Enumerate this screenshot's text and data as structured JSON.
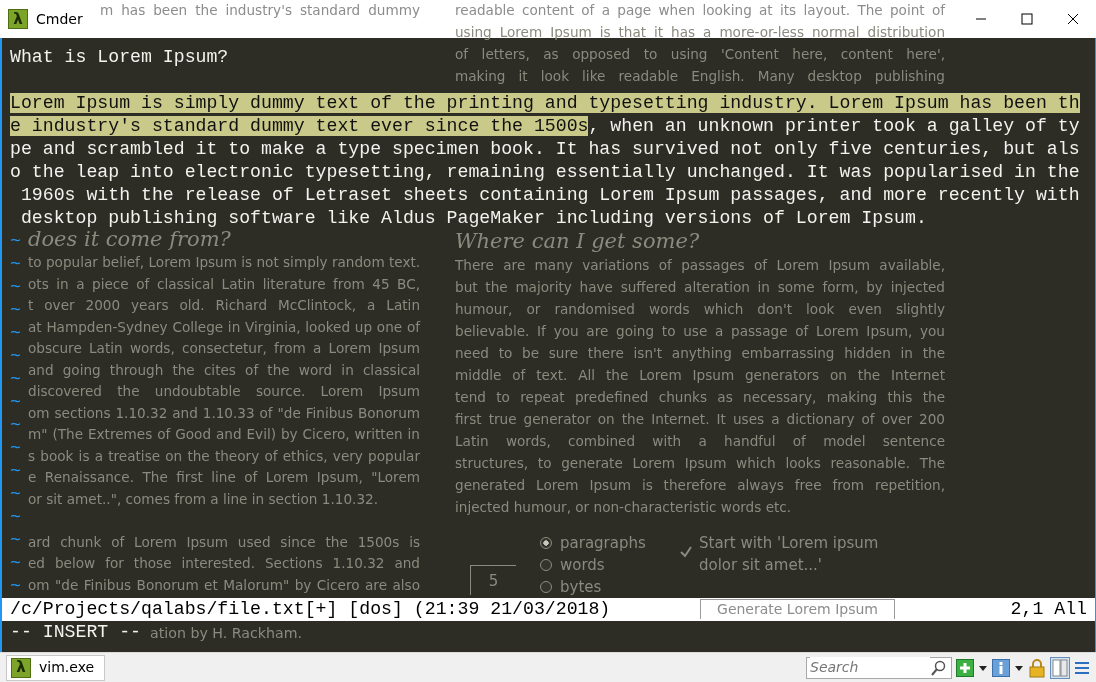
{
  "window": {
    "title": "Cmder",
    "icon_glyph": "λ"
  },
  "terminal": {
    "heading": "What is Lorem Ipsum?",
    "lines": [
      [
        {
          "text": "Lorem Ipsum is simply dummy text of the printing and typesetting industry. Lorem Ipsum has been th",
          "selected": true
        }
      ],
      [
        {
          "text": "e industry's standard dummy text ever since the 1500s",
          "selected": true
        },
        {
          "text": ", when an unknown printer took a galley of ty",
          "selected": false
        }
      ],
      [
        {
          "text": "pe and scrambled it to make a type specimen book. It has survived not only five centuries, but als",
          "selected": false
        }
      ],
      [
        {
          "text": "o the leap into electronic typesetting, remaining essentially unchanged. It was popularised in the",
          "selected": false
        }
      ],
      [
        {
          "text": " 1960s with the release of Letraset sheets containing Lorem Ipsum passages, and more recently with",
          "selected": false
        }
      ],
      [
        {
          "text": " desktop publishing software like Aldus PageMaker including versions of Lorem Ipsum.",
          "selected": false
        }
      ]
    ],
    "tildes": [
      "~",
      "~",
      "~",
      "~",
      "~",
      "~",
      "~",
      "~",
      "~",
      "~",
      "~",
      "~",
      "~",
      "~",
      "~",
      "~"
    ],
    "status_line": {
      "file": "/c/Projects/qalabs/file.txt[+] [dos] (21:39 21/03/2018)",
      "position": "2,1 All"
    },
    "mode_line": "-- INSERT --"
  },
  "page_behind": {
    "top_left": [
      "m has been the industry's standard dummy"
    ],
    "top_right": [
      "readable content of a page when looking at its layout. The point of",
      "using Lorem Ipsum is that it has a more-or-less normal distribution",
      "of letters, as opposed to using 'Content here, content here',",
      "making it look like readable English. Many desktop publishing"
    ],
    "left_heading": "does it come from?",
    "left_column": [
      "to popular belief, Lorem Ipsum is not simply random text.",
      "ots in a piece of classical Latin literature from 45 BC,",
      "t over 2000 years old. Richard McClintock, a Latin",
      "at Hampden-Sydney College in Virginia, looked up one of",
      "obscure Latin words, consectetur, from a Lorem Ipsum",
      "and going through the cites of the word in classical",
      "discovered the undoubtable source. Lorem Ipsum",
      "om sections 1.10.32 and 1.10.33 of \"de Finibus Bonorum",
      "m\" (The Extremes of Good and Evil) by Cicero, written in",
      "s book is a treatise on the theory of ethics, very popular",
      "e Renaissance. The first line of Lorem Ipsum, \"Lorem",
      "or sit amet..\", comes from a line in section 1.10.32."
    ],
    "left_column_2": [
      "ard chunk of Lorem Ipsum used since the 1500s is",
      "ed below for those interested. Sections 1.10.32 and",
      "om \"de Finibus Bonorum et Malorum\" by Cicero are also"
    ],
    "right_heading": "Where can I get some?",
    "right_column": [
      "There are many variations of passages of Lorem Ipsum available,",
      "but the majority have suffered alteration in some form, by injected",
      "humour, or randomised words which don't look even slightly",
      "believable. If you are going to use a passage of Lorem Ipsum, you",
      "need to be sure there isn't anything embarrassing hidden in the",
      "middle of text. All the Lorem Ipsum generators on the Internet",
      "tend to repeat predefined chunks as necessary, making this the",
      "first true generator on the Internet. It uses a dictionary of over 200",
      "Latin words, combined with a handful of model sentence",
      "structures, to generate Lorem Ipsum which looks reasonable. The",
      "generated Lorem Ipsum is therefore always free from repetition,",
      "injected humour, or non-characteristic words etc."
    ],
    "amount": "5",
    "units": [
      {
        "label": "paragraphs",
        "selected": true
      },
      {
        "label": "words",
        "selected": false
      },
      {
        "label": "bytes",
        "selected": false
      }
    ],
    "start_option": {
      "label": "Start with 'Lorem ipsum dolor sit amet...'",
      "checked": true
    },
    "generate_button": "Generate Lorem Ipsum",
    "footer_text": "ation by H. Rackham."
  },
  "tabs": [
    {
      "label": "vim.exe",
      "selected": true,
      "icon_glyph": "λ"
    }
  ],
  "search": {
    "placeholder": "Search"
  }
}
